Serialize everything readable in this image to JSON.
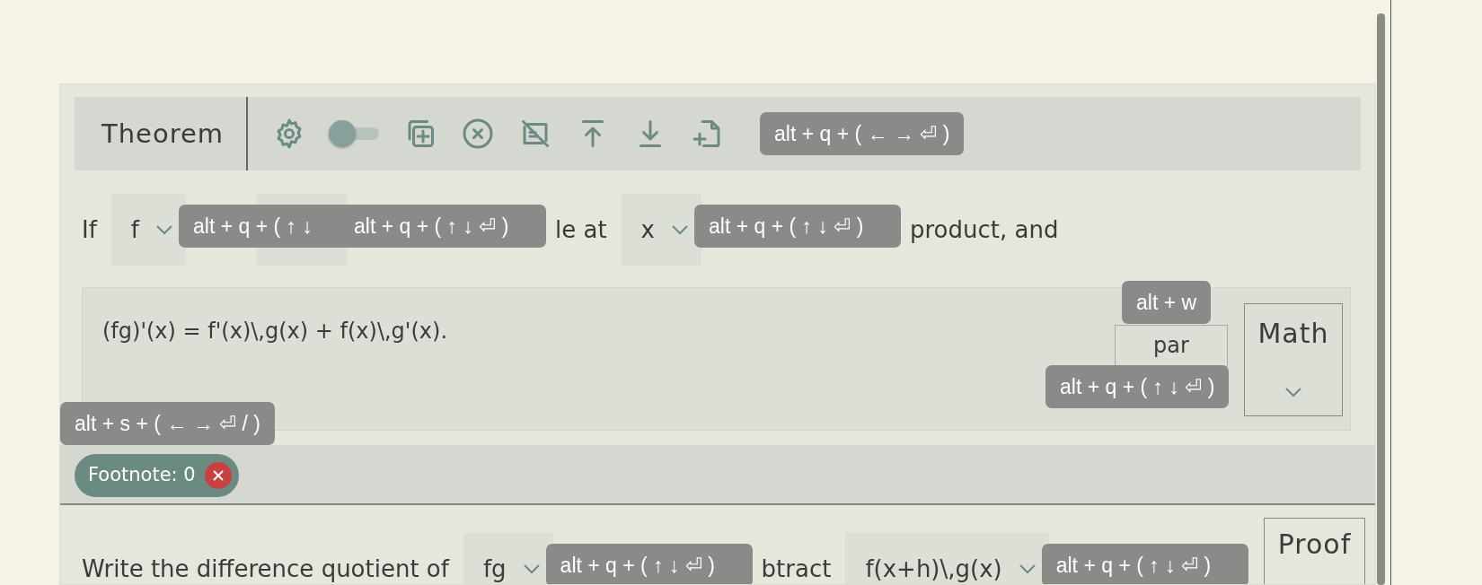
{
  "theorem": {
    "title": "Theorem",
    "toolbar": {
      "toggle": {
        "on": false
      },
      "shortcut": "alt + q + ( ← → ⏎ )"
    },
    "statement": [
      {
        "kind": "text",
        "text": "If"
      },
      {
        "kind": "select",
        "value": "f",
        "shortcut": "alt + q + ( ↑ ↓"
      },
      {
        "kind": "select",
        "shortcut": "alt + q + ( ↑ ↓ ⏎ )"
      },
      {
        "kind": "text",
        "text": "le at"
      },
      {
        "kind": "select",
        "value": "x",
        "shortcut": "alt + q + ( ↑ ↓ ⏎ )"
      },
      {
        "kind": "text",
        "text": "product, and"
      }
    ],
    "math": {
      "formula": "(fg)'(x) = f'(x)\\,g(x) + f(x)\\,g'(x).",
      "shortcut": "alt + s + ( ← → ⏎ / )",
      "par": {
        "label": "par",
        "hint": "alt + w",
        "shortcut": "alt + q + ( ↑ ↓ ⏎ )"
      },
      "type_select": "Math"
    },
    "footnote": "Footnote: 0"
  },
  "proof": {
    "statement": [
      {
        "kind": "text",
        "text": "Write the difference quotient of"
      },
      {
        "kind": "select",
        "value": "fg",
        "shortcut": "alt + q + ( ↑ ↓ ⏎ )"
      },
      {
        "kind": "text",
        "text": "btract"
      },
      {
        "kind": "select",
        "value": "f(x+h)\\,g(x)",
        "shortcut": "alt + q + ( ↑ ↓ ⏎ )"
      }
    ],
    "type_label": "Proof"
  }
}
